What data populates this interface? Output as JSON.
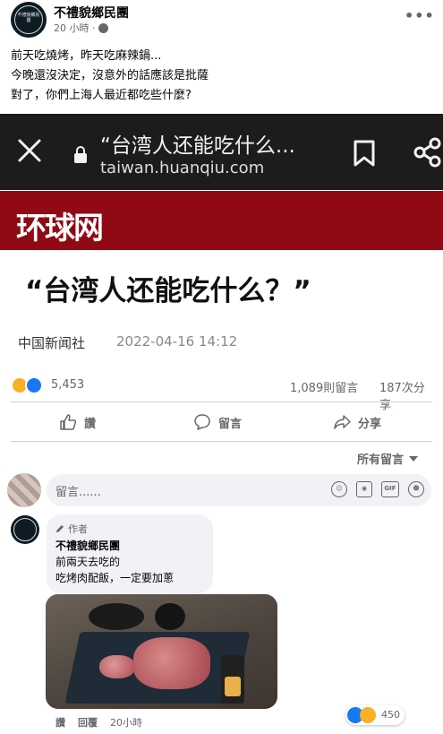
{
  "post": {
    "page_name": "不禮貌鄉民團",
    "time": "20 小時 ·",
    "avatar_text": "不禮貌鄉民團",
    "lines": [
      "前天吃燒烤，昨天吃麻辣鍋...",
      "今晚還沒決定，沒意外的話應該是批薩",
      "對了，你們上海人最近都吃些什麼?"
    ]
  },
  "shared_image": {
    "browser_title": "“台湾人还能吃什么...",
    "browser_url": "taiwan.huanqiu.com",
    "brand": "环球网",
    "article_title": "“台湾人还能吃什么？”",
    "source": "中国新闻社",
    "date": "2022-04-16 14:12"
  },
  "stats": {
    "reactions": "5,453",
    "comments": "1,089則留言",
    "shares": "187次分享"
  },
  "actions": {
    "like": "讚",
    "comment": "留言",
    "share": "分享"
  },
  "comments_section": {
    "sort_label": "所有留言",
    "composer_placeholder": "留言......",
    "composer_tools": [
      "emoji-icon",
      "camera-icon",
      "GIF",
      "sticker-icon"
    ]
  },
  "comment": {
    "badge": "作者",
    "author": "不禮貌鄉民團",
    "lines": [
      "前兩天去吃的",
      "吃烤肉配飯，一定要加蔥"
    ],
    "like_label": "讚",
    "reply_label": "回覆",
    "time": "20小時",
    "reaction_count": "450"
  },
  "colors": {
    "accent": "#1877f2",
    "muted": "#65676b",
    "brand_red": "#8f0a14",
    "browser_dark": "#1c1c1c"
  }
}
